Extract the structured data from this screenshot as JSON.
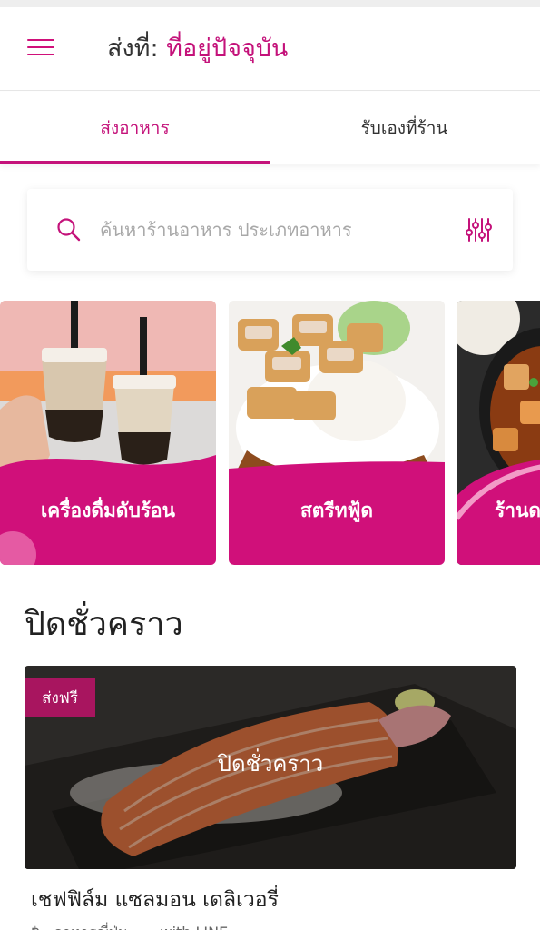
{
  "header": {
    "deliver_label": "ส่งที่:",
    "deliver_value": "ที่อยู่ปัจจุบัน",
    "menu_icon": "hamburger-menu-icon",
    "accent_color": "#c4127a"
  },
  "tabs": [
    {
      "label": "ส่งอาหาร",
      "active": true
    },
    {
      "label": "รับเองที่ร้าน",
      "active": false
    }
  ],
  "search": {
    "placeholder": "ค้นหาร้านอาหาร ประเภทอาหาร",
    "icon": "search-icon",
    "filter_icon": "filter-sliders-icon"
  },
  "categories": [
    {
      "label": "เครื่องดื่มดับร้อน"
    },
    {
      "label": "สตรีทฟู้ด"
    },
    {
      "label": "ร้านด"
    }
  ],
  "section": {
    "title": "ปิดชั่วคราว"
  },
  "restaurant": {
    "badge": "ส่งฟรี",
    "status": "ปิดชั่วคราว",
    "name": "เชฟฟิล์ม แซลมอน เดลิเวอรี่",
    "subtitle": "฿ · อาหารญี่ปุ่น · ... with LINE"
  }
}
